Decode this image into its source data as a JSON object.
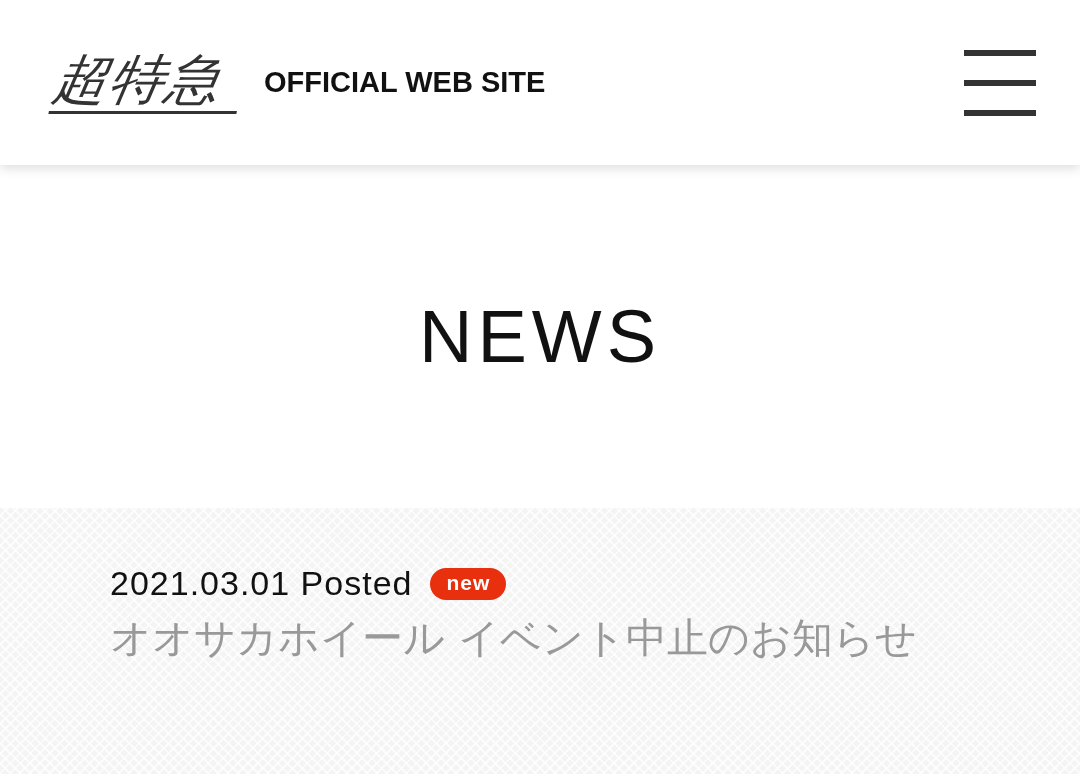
{
  "header": {
    "logo": "超特急",
    "site_label": "OFFICIAL WEB SITE"
  },
  "page_title": "NEWS",
  "news": [
    {
      "date": "2021.03.01 Posted",
      "is_new": true,
      "badge": "new",
      "title": "オオサカホイール イベント中止のお知らせ"
    }
  ]
}
